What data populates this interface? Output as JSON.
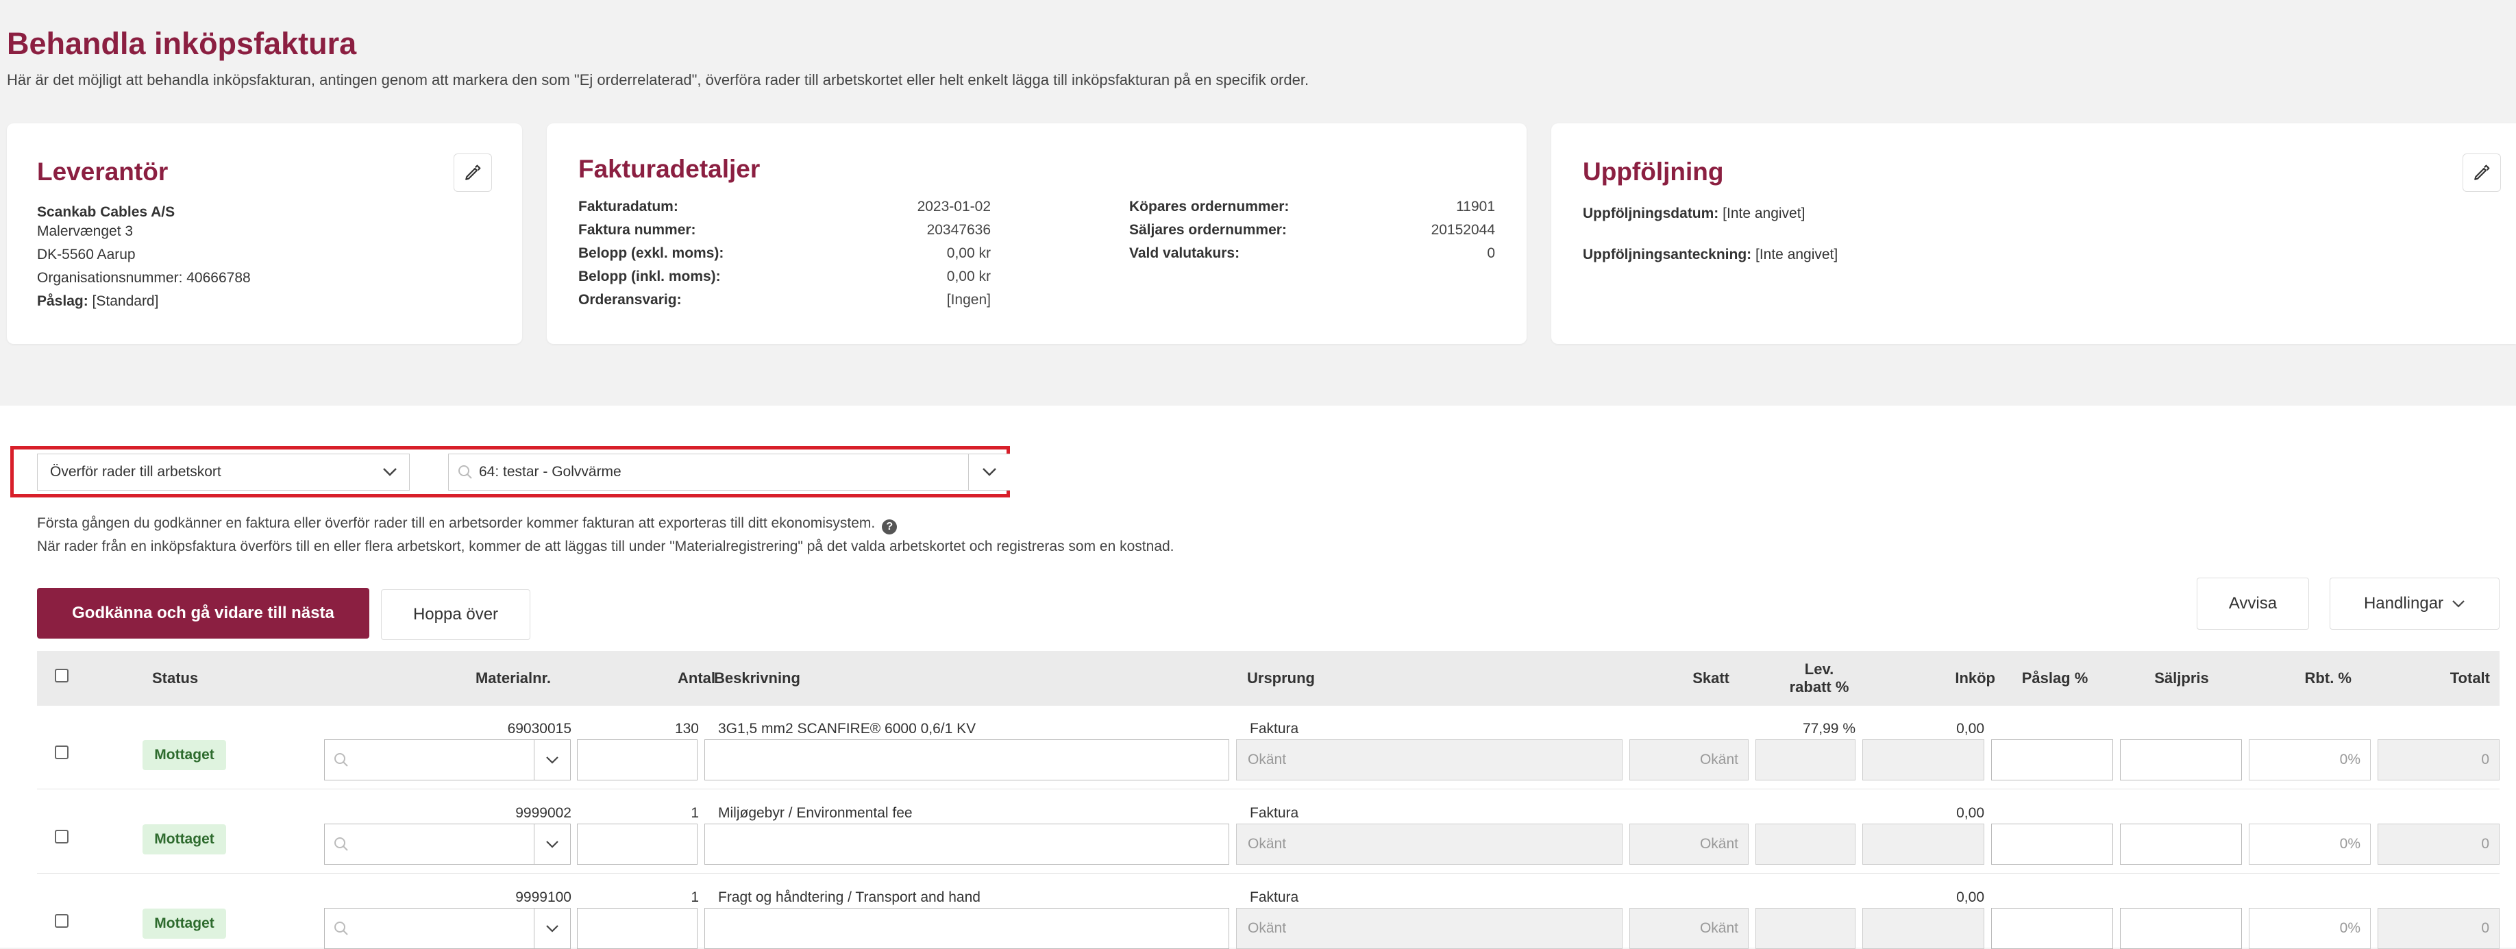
{
  "page": {
    "title": "Behandla inköpsfaktura",
    "description": "Här är det möjligt att behandla inköpsfakturan, antingen genom att markera den som \"Ej orderrelaterad\", överföra rader till arbetskortet eller helt enkelt lägga till inköpsfakturan på en specifik order."
  },
  "supplier": {
    "title": "Leverantör",
    "name": "Scankab Cables A/S",
    "street": "Malervænget 3",
    "city": "DK-5560 Aarup",
    "org_number": "Organisationsnummer: 40666788",
    "markup_label": "Påslag:",
    "markup_value": "[Standard]"
  },
  "invoice_details": {
    "title": "Fakturadetaljer",
    "left": [
      {
        "label": "Fakturadatum:",
        "value": "2023-01-02"
      },
      {
        "label": "Faktura nummer:",
        "value": "20347636"
      },
      {
        "label": "Belopp (exkl. moms):",
        "value": "0,00 kr"
      },
      {
        "label": "Belopp (inkl. moms):",
        "value": "0,00 kr"
      },
      {
        "label": "Orderansvarig:",
        "value": "[Ingen]"
      }
    ],
    "right": [
      {
        "label": "Köpares ordernummer:",
        "value": "11901"
      },
      {
        "label": "Säljares ordernummer:",
        "value": "20152044"
      },
      {
        "label": "Vald valutakurs:",
        "value": "0"
      }
    ]
  },
  "followup": {
    "title": "Uppföljning",
    "date_label": "Uppföljningsdatum:",
    "date_value": "[Inte angivet]",
    "note_label": "Uppföljningsanteckning:",
    "note_value": "[Inte angivet]"
  },
  "transfer": {
    "action_selected": "Överför rader till arbetskort",
    "work_order_value": "64: testar - Golvvärme"
  },
  "info": {
    "line1": "Första gången du godkänner en faktura eller överför rader till en arbetsorder kommer fakturan att exporteras till ditt ekonomisystem.",
    "line2": "När rader från en inköpsfaktura överförs till en eller flera arbetskort, kommer de att läggas till under \"Materialregistrering\" på det valda arbetskortet och registreras som en kostnad.",
    "help": "?"
  },
  "buttons": {
    "approve": "Godkänna och gå vidare till nästa",
    "skip": "Hoppa över",
    "reject": "Avvisa",
    "actions": "Handlingar"
  },
  "table": {
    "headers": {
      "status": "Status",
      "material": "Materialnr.",
      "qty": "Antal",
      "description": "Beskrivning",
      "origin": "Ursprung",
      "tax": "Skatt",
      "discount_line1": "Lev.",
      "discount_line2": "rabatt %",
      "purchase": "Inköp",
      "markup": "Påslag %",
      "sale_price": "Säljpris",
      "rbt": "Rbt. %",
      "total": "Totalt"
    },
    "rows": [
      {
        "status": "Mottaget",
        "material": "69030015",
        "qty": "130",
        "description": "3G1,5 mm2 SCANFIRE® 6000 0,6/1 KV",
        "origin": "Faktura",
        "origin_input": "Okänt",
        "tax": "Okänt",
        "discount": "77,99 %",
        "purchase": "0,00",
        "rbt": "0%",
        "total": "0"
      },
      {
        "status": "Mottaget",
        "material": "9999002",
        "qty": "1",
        "description": "Miljøgebyr / Environmental fee",
        "origin": "Faktura",
        "origin_input": "Okänt",
        "tax": "Okänt",
        "discount": "",
        "purchase": "0,00",
        "rbt": "0%",
        "total": "0"
      },
      {
        "status": "Mottaget",
        "material": "9999100",
        "qty": "1",
        "description": "Fragt og håndtering / Transport and hand",
        "origin": "Faktura",
        "origin_input": "Okänt",
        "tax": "Okänt",
        "discount": "",
        "purchase": "0,00",
        "rbt": "0%",
        "total": "0"
      }
    ]
  }
}
